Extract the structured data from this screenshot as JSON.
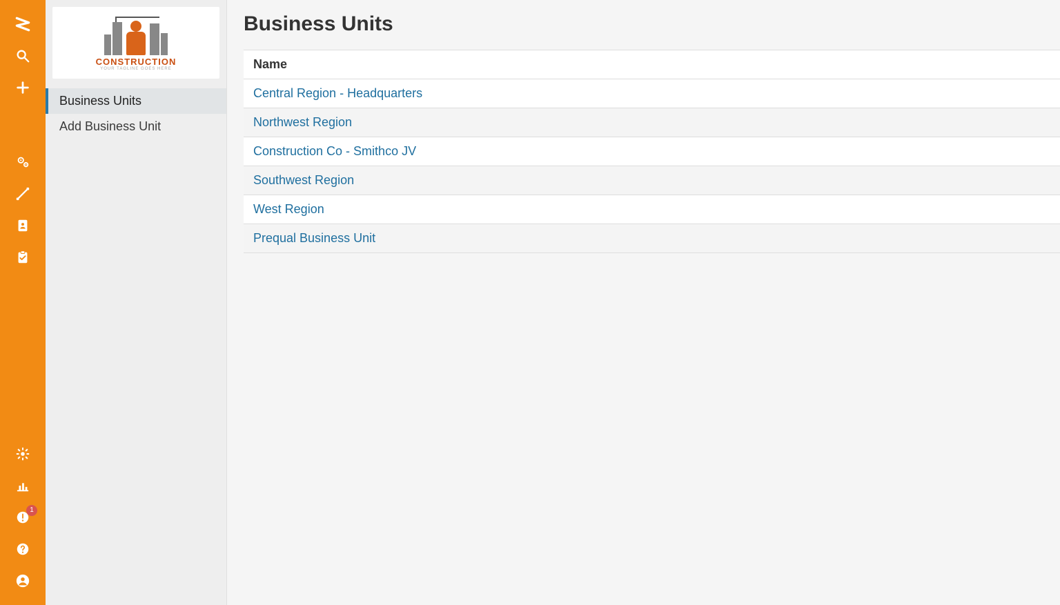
{
  "rail": {
    "notifications_badge": "1"
  },
  "sidebar": {
    "logo_title": "CONSTRUCTION",
    "logo_sub": "YOUR TAGLINE GOES HERE",
    "items": [
      {
        "label": "Business Units",
        "active": true
      },
      {
        "label": "Add Business Unit",
        "active": false
      }
    ]
  },
  "main": {
    "title": "Business Units",
    "table": {
      "header": "Name",
      "rows": [
        {
          "name": "Central Region - Headquarters"
        },
        {
          "name": "Northwest Region"
        },
        {
          "name": "Construction Co - Smithco JV"
        },
        {
          "name": "Southwest Region"
        },
        {
          "name": "West Region"
        },
        {
          "name": "Prequal Business Unit"
        }
      ]
    }
  }
}
